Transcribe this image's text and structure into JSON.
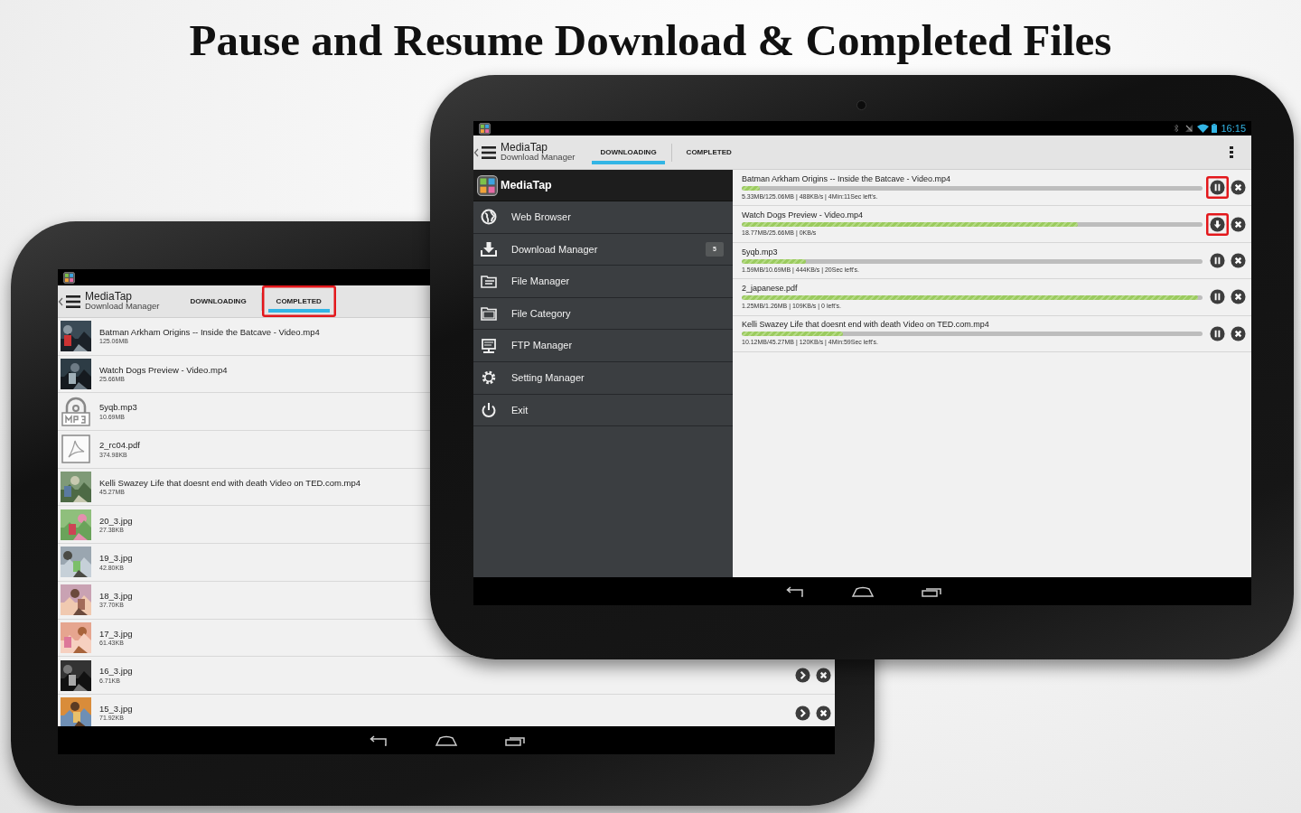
{
  "headline": "Pause and Resume Download & Completed Files",
  "back_tablet": {
    "app_title": "MediaTap",
    "app_subtitle": "Download Manager",
    "tabs": [
      {
        "label": "DOWNLOADING",
        "selected": false,
        "highlighted": false
      },
      {
        "label": "COMPLETED",
        "selected": true,
        "highlighted": true
      }
    ],
    "files": [
      {
        "name": "Batman Arkham Origins -- Inside the Batcave - Video.mp4",
        "size": "125.06MB",
        "kind": "video"
      },
      {
        "name": "Watch Dogs Preview - Video.mp4",
        "size": "25.66MB",
        "kind": "video"
      },
      {
        "name": "5yqb.mp3",
        "size": "10.69MB",
        "kind": "audio"
      },
      {
        "name": "2_rc04.pdf",
        "size": "374.98KB",
        "kind": "pdf"
      },
      {
        "name": "Kelli Swazey Life that doesnt end with death  Video on TED.com.mp4",
        "size": "45.27MB",
        "kind": "video"
      },
      {
        "name": "20_3.jpg",
        "size": "27.38KB"
      },
      {
        "name": "19_3.jpg",
        "size": "42.80KB"
      },
      {
        "name": "18_3.jpg",
        "size": "37.70KB"
      },
      {
        "name": "17_3.jpg",
        "size": "61.43KB"
      },
      {
        "name": "16_3.jpg",
        "size": "6.71KB",
        "buttons": [
          {
            "kind": "open"
          },
          {
            "kind": "delete"
          }
        ]
      },
      {
        "name": "15_3.jpg",
        "size": "71.92KB",
        "buttons": [
          {
            "kind": "open"
          },
          {
            "kind": "delete"
          }
        ]
      }
    ]
  },
  "front_tablet": {
    "status_bar": {
      "time": "16:15"
    },
    "app_title": "MediaTap",
    "app_subtitle": "Download Manager",
    "tabs": [
      {
        "label": "DOWNLOADING",
        "selected": true,
        "highlighted": false
      },
      {
        "label": "COMPLETED",
        "selected": false,
        "highlighted": false
      }
    ],
    "drawer": {
      "title": "MediaTap",
      "items": [
        {
          "label": "Web Browser",
          "kind": "globe"
        },
        {
          "label": "Download Manager",
          "kind": "download",
          "badge": "5"
        },
        {
          "label": "File Manager",
          "kind": "files"
        },
        {
          "label": "File Category",
          "kind": "folder"
        },
        {
          "label": "FTP Manager",
          "kind": "monitor"
        },
        {
          "label": "Setting Manager",
          "kind": "gear"
        },
        {
          "label": "Exit",
          "kind": "power"
        }
      ]
    },
    "downloads": [
      {
        "name": "Batman Arkham Origins -- Inside the Batcave - Video.mp4",
        "level": 0.04,
        "status": "5.33MB/125.06MB | 488KB/s | 4Min:11Sec left's.",
        "kind": "pause",
        "highlighted": true
      },
      {
        "name": "Watch Dogs Preview - Video.mp4",
        "level": 0.73,
        "status": "18.77MB/25.66MB | 0KB/s",
        "kind": "resume",
        "highlighted": true
      },
      {
        "name": "5yqb.mp3",
        "level": 0.14,
        "status": "1.59MB/10.69MB | 444KB/s | 20Sec left's.",
        "kind": "pause",
        "highlighted": false
      },
      {
        "name": "2_japanese.pdf",
        "level": 0.99,
        "status": "1.25MB/1.26MB | 109KB/s | 0 left's.",
        "kind": "pause",
        "highlighted": false
      },
      {
        "name": "Kelli Swazey Life that doesnt end with death  Video on TED.com.mp4",
        "level": 0.22,
        "status": "10.12MB/45.27MB | 120KB/s | 4Min:59Sec left's.",
        "kind": "pause",
        "highlighted": false
      }
    ]
  }
}
